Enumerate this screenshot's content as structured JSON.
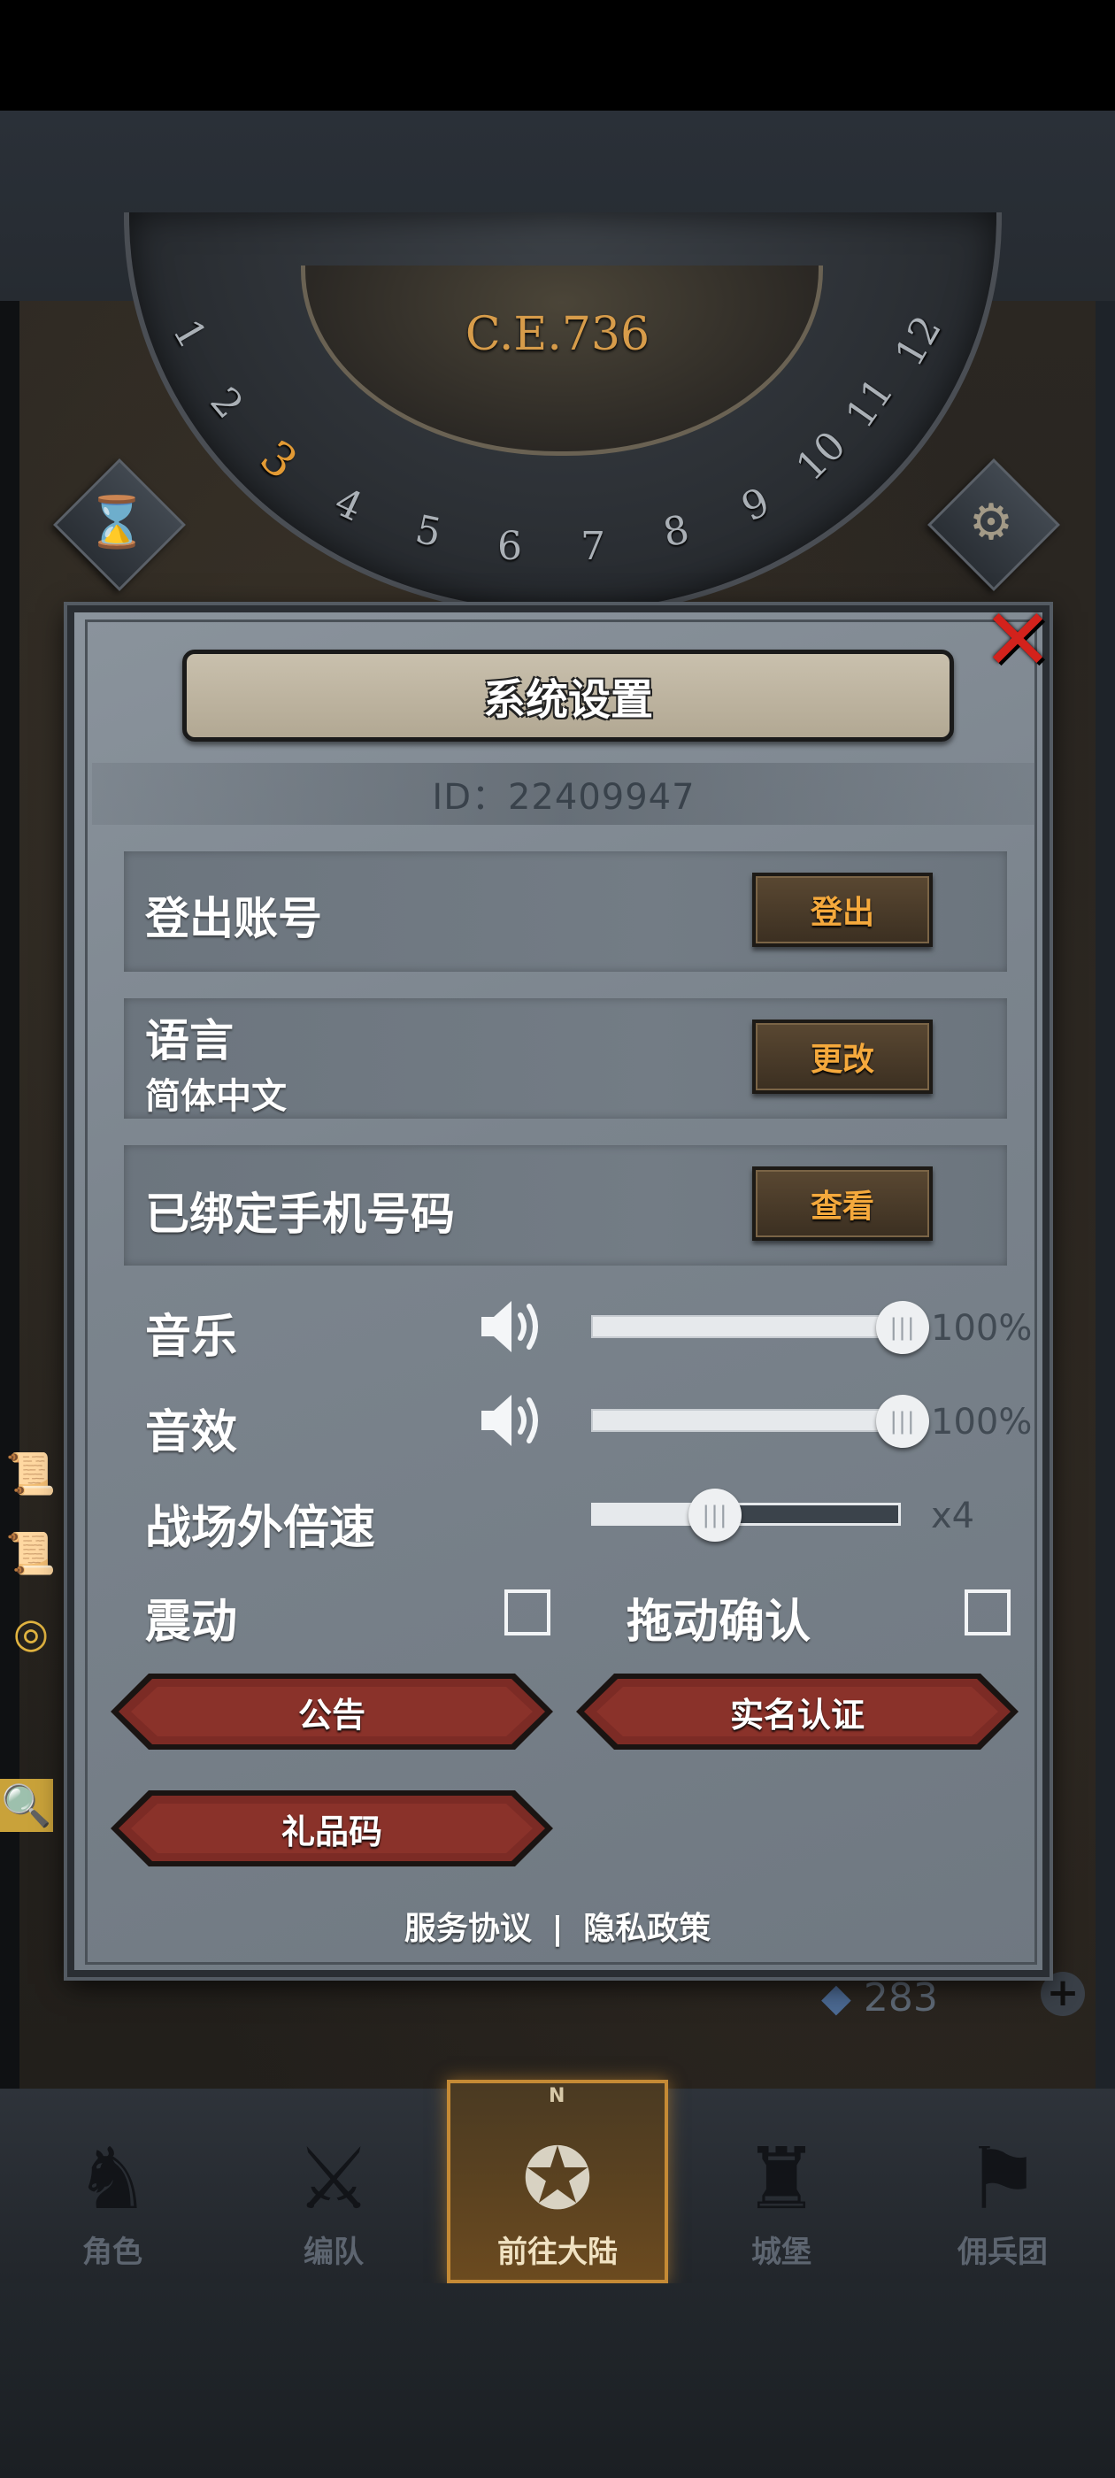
{
  "game": {
    "year": "C.E.736",
    "months": [
      "1",
      "2",
      "3",
      "4",
      "5",
      "6",
      "7",
      "8",
      "9",
      "10",
      "11",
      "12"
    ],
    "current_month": "3",
    "resource_value": "283"
  },
  "dialog": {
    "title": "系统设置",
    "id_text": "ID：22409947",
    "logout_label": "登出账号",
    "logout_button": "登出",
    "language_label": "语言",
    "language_value": "简体中文",
    "language_button": "更改",
    "phone_label": "已绑定手机号码",
    "phone_button": "查看",
    "music_label": "音乐",
    "music_value": "100%",
    "music_level": 1.0,
    "sfx_label": "音效",
    "sfx_value": "100%",
    "sfx_level": 1.0,
    "speed_label": "战场外倍速",
    "speed_value": "x4",
    "speed_level": 0.4,
    "vibrate_label": "震动",
    "vibrate_checked": false,
    "drag_confirm_label": "拖动确认",
    "drag_confirm_checked": false,
    "notice_button": "公告",
    "realname_button": "实名认证",
    "giftcode_button": "礼品码",
    "terms_link": "服务协议",
    "separator": "|",
    "privacy_link": "隐私政策"
  },
  "nav": {
    "items": [
      {
        "label": "角色",
        "icon": "knight-helmet-icon"
      },
      {
        "label": "编队",
        "icon": "party-icon"
      },
      {
        "label": "前往大陆",
        "icon": "compass-icon"
      },
      {
        "label": "城堡",
        "icon": "castle-icon"
      },
      {
        "label": "佣兵团",
        "icon": "mercenary-icon"
      }
    ],
    "active_index": 2,
    "compass_north": "N"
  },
  "colors": {
    "accent_gold": "#e29a34",
    "close_red": "#d3221c",
    "button_red": "#7a2a24",
    "panel_gray": "#7b848d"
  }
}
